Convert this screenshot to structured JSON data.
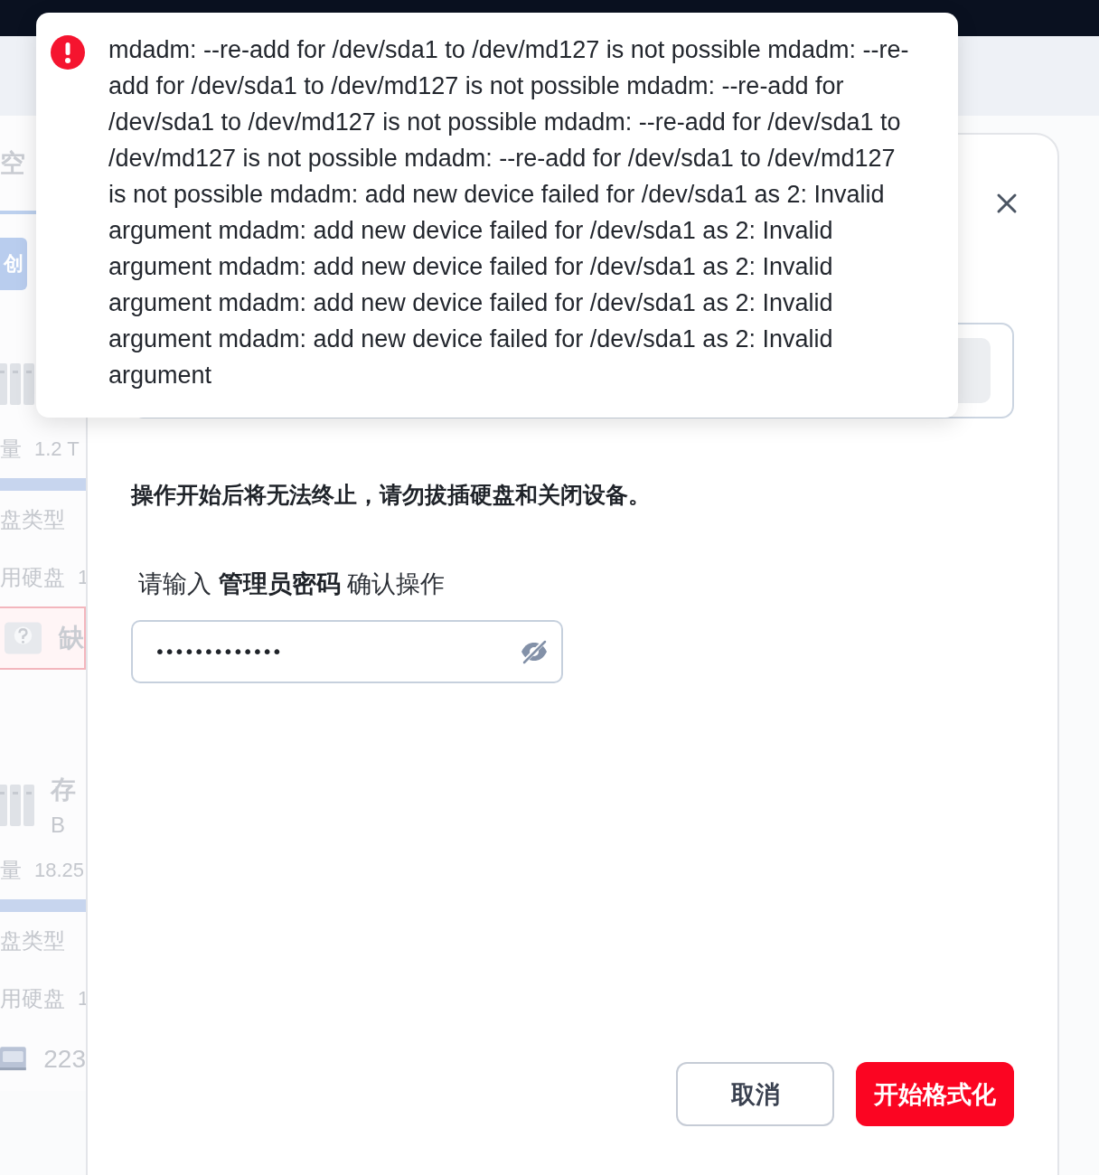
{
  "background": {
    "section_title": "空",
    "create_button": "创",
    "pools": [
      {
        "kind": "hdd",
        "capacity_label": "量",
        "capacity": "1.2 T",
        "disk_type_label": "盘类型",
        "disks_label": "用硬盘",
        "disks": "1",
        "alert": "缺"
      },
      {
        "kind": "ssd",
        "name": "存",
        "subtitle": "B",
        "capacity_label": "量",
        "capacity": "18.25",
        "disk_type_label": "盘类型",
        "disks_label": "用硬盘",
        "disks": "1",
        "disk_size": "223"
      }
    ]
  },
  "error_toast": {
    "message": "mdadm: --re-add for /dev/sda1 to /dev/md127 is not possible mdadm: --re-add for /dev/sda1 to /dev/md127 is not possible mdadm: --re-add for /dev/sda1 to /dev/md127 is not possible mdadm: --re-add for /dev/sda1 to /dev/md127 is not possible mdadm: --re-add for /dev/sda1 to /dev/md127 is not possible mdadm: add new device failed for /dev/sda1 as 2: Invalid argument mdadm: add new device failed for /dev/sda1 as 2: Invalid argument mdadm: add new device failed for /dev/sda1 as 2: Invalid argument mdadm: add new device failed for /dev/sda1 as 2: Invalid argument mdadm: add new device failed for /dev/sda1 as 2: Invalid argument"
  },
  "dialog": {
    "warning": "操作开始后将无法终止，请勿拔插硬盘和关闭设备。",
    "prompt": "请输入 **管理员密码** 确认操作",
    "password": {
      "value": "•••••••••••••",
      "visible": false
    },
    "buttons": [
      {
        "label": "取消",
        "kind": "secondary"
      },
      {
        "label": "开始格式化",
        "kind": "danger"
      }
    ]
  }
}
